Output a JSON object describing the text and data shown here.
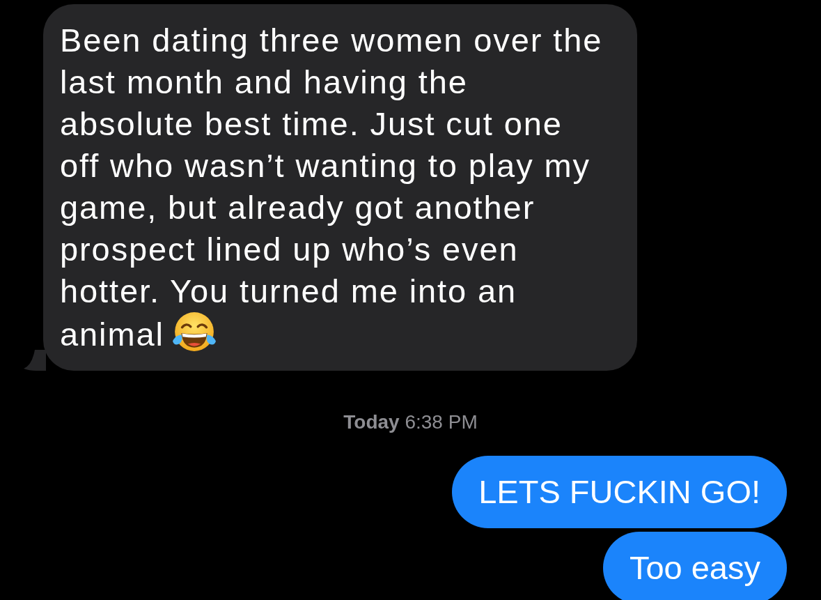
{
  "messages": [
    {
      "kind": "incoming",
      "text": "Been dating three women over the last month and having the absolute best time. Just cut one off who wasn’t wanting to play my game, but already got another prospect lined up who’s even hotter. You turned me into an animal",
      "has_emoji": true,
      "tail": true
    },
    {
      "kind": "timestamp",
      "text": "**Today** 6:38 PM"
    },
    {
      "kind": "outgoing",
      "text": "LETS FUCKIN GO!",
      "tail": false
    },
    {
      "kind": "outgoing",
      "text": "Too easy",
      "tail": false
    }
  ]
}
